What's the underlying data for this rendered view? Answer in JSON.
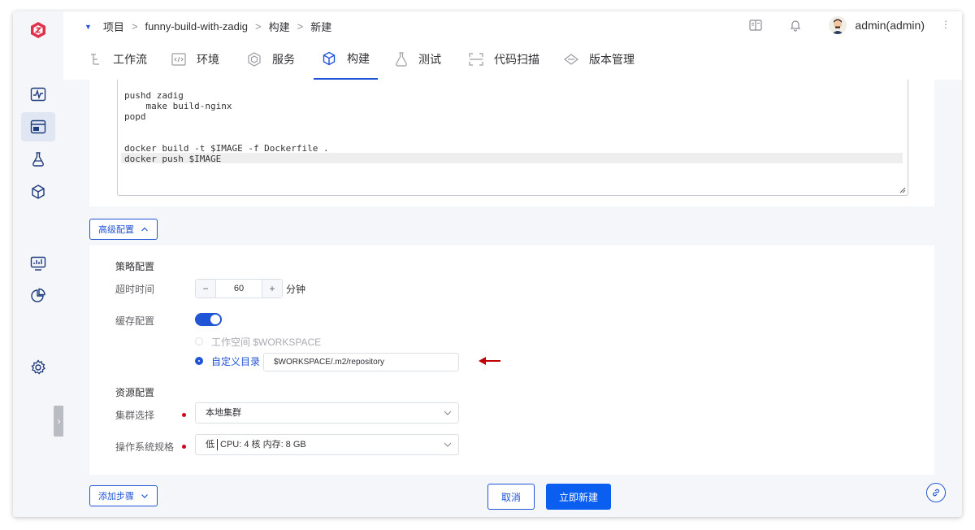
{
  "breadcrumb": {
    "items": [
      "项目",
      "funny-build-with-zadig",
      "构建",
      "新建"
    ],
    "separator": ">"
  },
  "user": {
    "name": "admin(admin)"
  },
  "tabs": [
    {
      "label": "工作流",
      "icon": "workflow-icon"
    },
    {
      "label": "环境",
      "icon": "environment-icon"
    },
    {
      "label": "服务",
      "icon": "service-icon"
    },
    {
      "label": "构建",
      "icon": "build-cube-icon",
      "active": true
    },
    {
      "label": "测试",
      "icon": "test-flask-icon"
    },
    {
      "label": "代码扫描",
      "icon": "code-scan-icon"
    },
    {
      "label": "版本管理",
      "icon": "version-diamond-icon"
    }
  ],
  "script": {
    "lines": [
      "pushd zadig",
      "    make build-nginx",
      "popd",
      "",
      "",
      "docker build -t $IMAGE -f Dockerfile .",
      "docker push $IMAGE"
    ]
  },
  "advanced": {
    "toggle_label": "高级配置"
  },
  "strategy": {
    "title": "策略配置",
    "timeout_label": "超时时间",
    "timeout_value": "60",
    "timeout_unit": "分钟",
    "decrement": "−",
    "increment": "+",
    "cache_label": "缓存配置",
    "cache_enabled": true,
    "option_workspace": "工作空间 $WORKSPACE",
    "option_custom": "自定义目录",
    "custom_path": "$WORKSPACE/.m2/repository"
  },
  "resource": {
    "title": "资源配置",
    "cluster_label": "集群选择",
    "cluster_value": "本地集群",
    "spec_label": "操作系统规格",
    "spec_level": "低",
    "spec_detail": "CPU: 4 核 内存: 8 GB"
  },
  "footer": {
    "add_step": "添加步骤",
    "cancel": "取消",
    "create": "立即新建"
  },
  "colors": {
    "primary": "#2055d5",
    "create_button": "#0b5ff0",
    "required": "#d0021b",
    "arrow": "#c00000"
  }
}
